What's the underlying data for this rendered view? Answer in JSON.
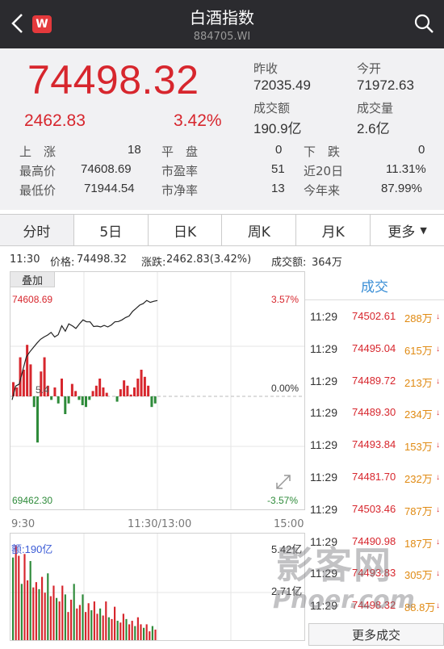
{
  "header": {
    "title": "白酒指数",
    "code": "884705.WI",
    "logo": "W"
  },
  "quote": {
    "price": "74498.32",
    "change": "2462.83",
    "change_pct": "3.42%",
    "prev_close_label": "昨收",
    "prev_close": "72035.49",
    "open_label": "今开",
    "open": "71972.63",
    "turnover_label": "成交额",
    "turnover": "190.9亿",
    "volume_label": "成交量",
    "volume": "2.6亿"
  },
  "stats": {
    "up_label": "上　涨",
    "up": "18",
    "flat_label": "平　盘",
    "flat": "0",
    "down_label": "下　跌",
    "down": "0",
    "high_label": "最高价",
    "high": "74608.69",
    "pe_label": "市盈率",
    "pe": "51",
    "d20_label": "近20日",
    "d20": "11.31%",
    "low_label": "最低价",
    "low": "71944.54",
    "pb_label": "市净率",
    "pb": "13",
    "ytd_label": "今年来",
    "ytd": "87.99%"
  },
  "tabs": [
    "分时",
    "5日",
    "日K",
    "周K",
    "月K",
    "更多"
  ],
  "info": {
    "time": "11:30",
    "price_label": "价格:",
    "price": "74498.32",
    "chg_label": "涨跌:",
    "chg": "2462.83(3.42%)",
    "amt_label": "成交额:",
    "amt": "364万"
  },
  "chart": {
    "overlay_label": "叠加",
    "top_price": "74608.69",
    "top_pct": "3.57%",
    "mid_pct": "0.00%",
    "bottom_price": "69462.30",
    "bottom_pct": "-3.57%",
    "mid_left": "5.4",
    "time_start": "9:30",
    "time_mid": "11:30/13:00",
    "time_end": "15:00",
    "vol_label": "额:190亿",
    "vol_top": "5.42亿",
    "vol_mid": "2.71亿"
  },
  "chart_data": {
    "type": "line",
    "ylim_price": [
      69462.3,
      74608.69
    ],
    "ylim_pct": [
      -3.57,
      3.57
    ],
    "price_series": [
      71944.5,
      72300,
      72350,
      72700,
      73050,
      73180,
      73290,
      73400,
      73500,
      73560,
      73610,
      73680,
      73560,
      73620,
      73850,
      73710,
      73900,
      73850,
      73780,
      73900,
      74000,
      73950,
      73950,
      73830,
      73840,
      73820,
      73860,
      73820,
      73870,
      73950,
      73960,
      74000,
      74060,
      74100,
      74220,
      74300,
      74380,
      74420,
      74500,
      74450,
      74480,
      74498.3
    ],
    "bar_series": [
      0.8,
      0.5,
      2.2,
      1.5,
      2.9,
      1.8,
      -0.6,
      -2.6,
      1.4,
      2.2,
      0.6,
      -0.2,
      0.5,
      -0.4,
      1.0,
      -1.0,
      -0.4,
      0.7,
      0.3,
      -0.2,
      -0.5,
      -0.6,
      -0.2,
      0.3,
      0.6,
      1.0,
      0.5,
      0.2,
      0.0,
      0.0,
      -0.3,
      0.4,
      0.9,
      0.6,
      0.1,
      0.5,
      1.0,
      1.5,
      1.1,
      0.6,
      -0.6,
      -0.4
    ],
    "volume_series": [
      4.7,
      5.4,
      4.8,
      3.2,
      4.9,
      3.4,
      4.5,
      3.0,
      3.3,
      2.9,
      3.6,
      2.7,
      3.8,
      2.5,
      3.1,
      2.4,
      2.2,
      3.1,
      2.6,
      1.6,
      2.3,
      3.2,
      1.8,
      2.0,
      2.6,
      1.6,
      2.1,
      1.7,
      2.2,
      1.5,
      1.8,
      1.4,
      2.2,
      1.3,
      1.2,
      1.9,
      1.1,
      1.0,
      1.5,
      1.2,
      0.9,
      1.1,
      0.8,
      1.3,
      0.9,
      0.7,
      0.9,
      0.5,
      0.8,
      0.6
    ],
    "vol_ylim": [
      0,
      5.42
    ]
  },
  "trades": {
    "header": "成交",
    "rows": [
      {
        "time": "11:29",
        "price": "74502.61",
        "vol": "288万"
      },
      {
        "time": "11:29",
        "price": "74495.04",
        "vol": "615万"
      },
      {
        "time": "11:29",
        "price": "74489.72",
        "vol": "213万"
      },
      {
        "time": "11:29",
        "price": "74489.30",
        "vol": "234万"
      },
      {
        "time": "11:29",
        "price": "74493.84",
        "vol": "153万"
      },
      {
        "time": "11:29",
        "price": "74481.70",
        "vol": "232万"
      },
      {
        "time": "11:29",
        "price": "74503.46",
        "vol": "787万"
      },
      {
        "time": "11:29",
        "price": "74490.98",
        "vol": "187万"
      },
      {
        "time": "11:29",
        "price": "74493.83",
        "vol": "305万"
      },
      {
        "time": "11:29",
        "price": "74498.32",
        "vol": "88.8万"
      }
    ],
    "more_label": "更多成交"
  },
  "watermark": {
    "line1": "影客网",
    "line2": "Phoer.com"
  },
  "colors": {
    "up": "#d7262d",
    "down": "#2e8b3a",
    "accent": "#3b8fd6",
    "volume_orange": "#e08a12"
  }
}
